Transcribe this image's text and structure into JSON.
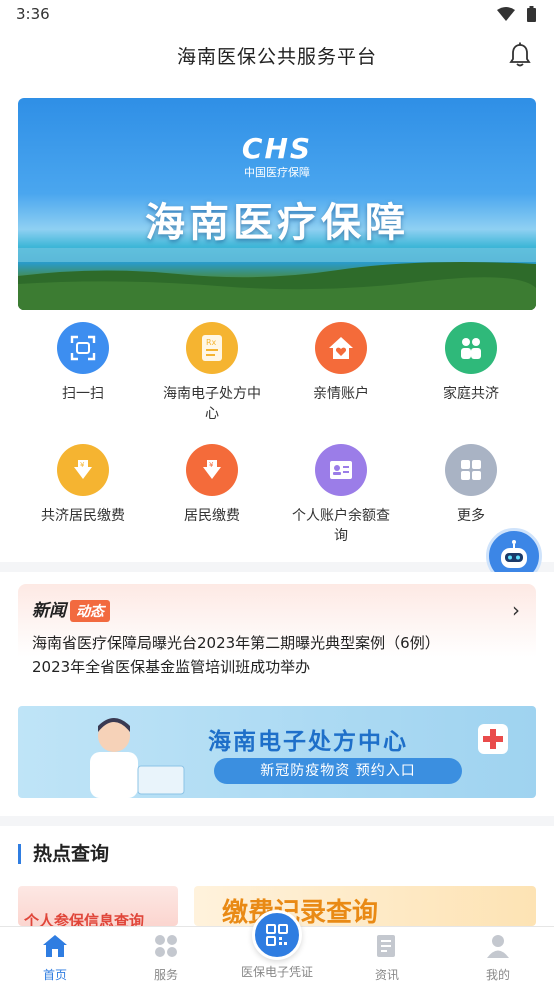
{
  "status_bar": {
    "time": "3:36"
  },
  "header": {
    "title": "海南医保公共服务平台"
  },
  "banner": {
    "logo_text": "CHS",
    "logo_sub": "中国医疗保障",
    "title": "海南医疗保障"
  },
  "grid": [
    {
      "label": "扫一扫",
      "icon": "scan-icon",
      "color": "#3d8ef0"
    },
    {
      "label": "海南电子处方中心",
      "icon": "prescription-icon",
      "color": "#f5b431"
    },
    {
      "label": "亲情账户",
      "icon": "home-heart-icon",
      "color": "#f46b3a"
    },
    {
      "label": "家庭共济",
      "icon": "family-icon",
      "color": "#2fb97a"
    },
    {
      "label": "共济居民缴费",
      "icon": "payment-arrow-icon",
      "color": "#f5b431"
    },
    {
      "label": "居民缴费",
      "icon": "payment-down-icon",
      "color": "#f46b3a"
    },
    {
      "label": "个人账户余额查询",
      "icon": "account-card-icon",
      "color": "#9b7de8"
    },
    {
      "label": "更多",
      "icon": "more-grid-icon",
      "color": "#a9b3c4"
    }
  ],
  "news": {
    "title": "新闻",
    "badge": "动态",
    "items": [
      "海南省医疗保障局曝光台2023年第二期曝光典型案例（6例）",
      "2023年全省医保基金监管培训班成功举办"
    ]
  },
  "promo": {
    "title": "海南电子处方中心",
    "subtitle": "新冠防疫物资 预约入口"
  },
  "hot": {
    "title": "热点查询",
    "card_a": "个人参保信息查询",
    "card_b": "缴费记录查询"
  },
  "tabbar": [
    {
      "label": "首页",
      "icon": "home-icon",
      "active": true
    },
    {
      "label": "服务",
      "icon": "services-icon",
      "active": false
    },
    {
      "label": "医保电子凭证",
      "icon": "qr-code-icon",
      "active": false
    },
    {
      "label": "资讯",
      "icon": "news-icon",
      "active": false
    },
    {
      "label": "我的",
      "icon": "profile-icon",
      "active": false
    }
  ]
}
